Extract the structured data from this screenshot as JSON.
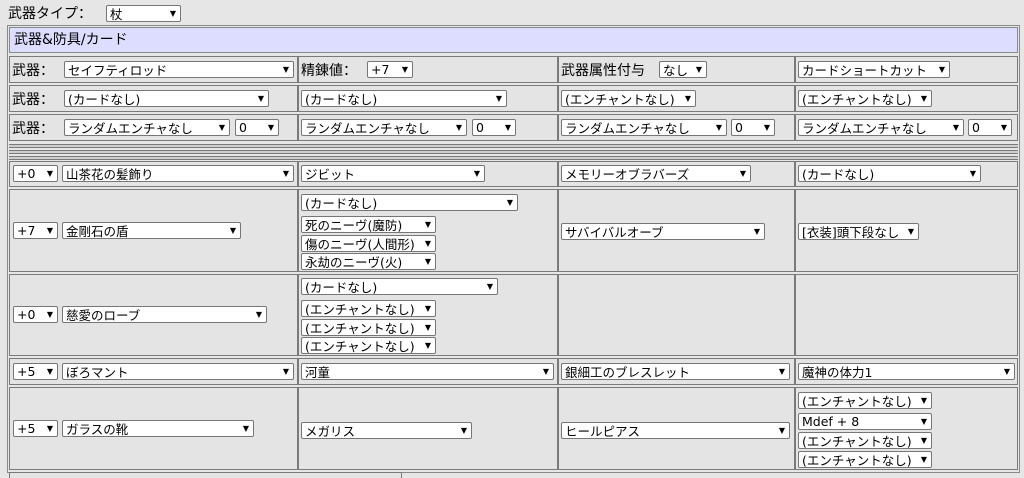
{
  "weapon_type": {
    "label": "武器タイプ：",
    "value": "杖"
  },
  "section_title": "武器&防具/カード",
  "row1": {
    "weapon_label": "武器：",
    "weapon_value": "セイフティロッド",
    "refine_label": "精錬値：",
    "refine_value": "+7",
    "element_label": "武器属性付与",
    "element_value": "なし",
    "shortcut_value": "カードショートカット"
  },
  "row2": {
    "label": "武器：",
    "card1": "(カードなし)",
    "card2": "(カードなし)",
    "card3": "(エンチャントなし)",
    "card4": "(エンチャントなし)"
  },
  "row3": {
    "label": "武器：",
    "e1": "ランダムエンチャなし",
    "n1": "0",
    "e2": "ランダムエンチャなし",
    "n2": "0",
    "e3": "ランダムエンチャなし",
    "n3": "0",
    "e4": "ランダムエンチャなし",
    "n4": "0"
  },
  "head": {
    "refine": "+0",
    "item": "山茶花の髪飾り",
    "card": "ジビット",
    "mid": "メモリーオブラバーズ",
    "low": "(カードなし)"
  },
  "shield": {
    "refine": "+7",
    "item": "金剛石の盾",
    "card": "(カードなし)",
    "opt1": "死のニーヴ(魔防)",
    "opt2": "傷のニーヴ(人間形)",
    "opt3": "永劫のニーヴ(火)",
    "col3": "サバイバルオーブ",
    "col4": "[衣装]頭下段なし"
  },
  "armor": {
    "refine": "+0",
    "item": "慈愛のローブ",
    "card": "(カードなし)",
    "opt1": "(エンチャントなし)",
    "opt2": "(エンチャントなし)",
    "opt3": "(エンチャントなし)"
  },
  "garment": {
    "refine": "+5",
    "item": "ぼろマント",
    "card": "河童",
    "col3": "銀細工のブレスレット",
    "col4": "魔神の体力1"
  },
  "shoes": {
    "refine": "+5",
    "item": "ガラスの靴",
    "card": "メガリス",
    "col3": "ヒールピアス",
    "opt1": "(エンチャントなし)",
    "opt2": "Mdef + 8",
    "opt3": "(エンチャントなし)",
    "opt4": "(エンチャントなし)"
  }
}
